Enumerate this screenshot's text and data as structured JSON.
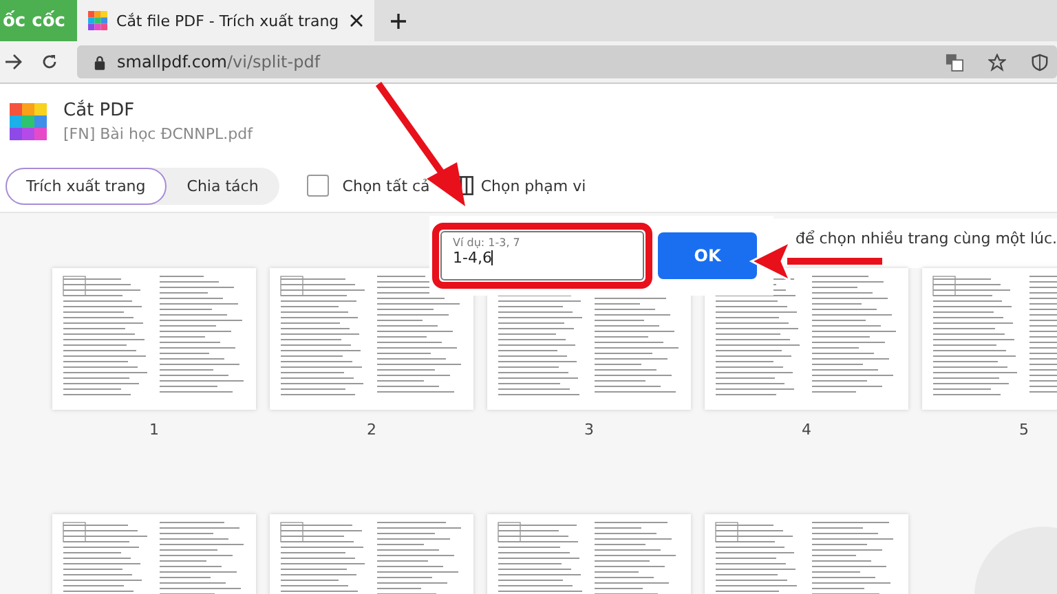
{
  "browser": {
    "tabs": [
      {
        "title": "ốc cốc",
        "kind": "brand",
        "selected": false
      },
      {
        "title": "Cắt file PDF - Trích xuất trang",
        "kind": "page",
        "selected": true
      }
    ],
    "url_host": "smallpdf.com",
    "url_path": "/vi/split-pdf"
  },
  "header": {
    "title": "Cắt PDF",
    "filename": "[FN] Bài học ĐCNNPL.pdf"
  },
  "modes": [
    {
      "label": "Trích xuất trang",
      "selected": true
    },
    {
      "label": "Chia tách",
      "selected": false
    }
  ],
  "select_all": {
    "label": "Chọn tất cả",
    "checked": false
  },
  "select_range": {
    "label": "Chọn phạm vi"
  },
  "range_popup": {
    "placeholder": "Ví dụ: 1-3, 7",
    "value": "1-4,6",
    "button": "OK"
  },
  "hint": "để chọn nhiều trang cùng một lúc.",
  "pages": [
    {
      "kind": "numbered",
      "number": "1"
    },
    {
      "kind": "numbered",
      "number": "2"
    },
    {
      "kind": "numbered",
      "number": "3"
    },
    {
      "kind": "numbered",
      "number": "4"
    },
    {
      "kind": "numbered",
      "number": "5"
    },
    {
      "kind": "unnumbered"
    },
    {
      "kind": "unnumbered"
    },
    {
      "kind": "unnumbered"
    },
    {
      "kind": "unnumbered"
    }
  ]
}
